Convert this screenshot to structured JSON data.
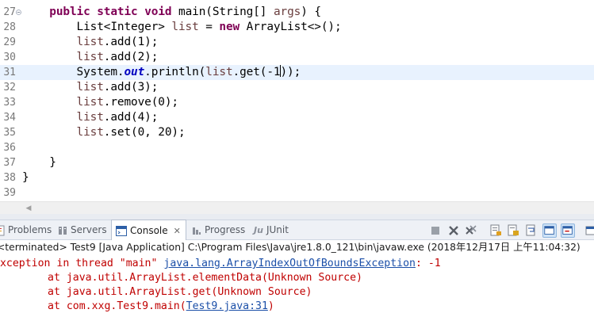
{
  "editor": {
    "lines": [
      {
        "no": "27",
        "fold": true,
        "tokens": [
          {
            "t": "    "
          },
          {
            "t": "public",
            "c": "kw"
          },
          {
            "t": " "
          },
          {
            "t": "static",
            "c": "kw"
          },
          {
            "t": " "
          },
          {
            "t": "void",
            "c": "kw"
          },
          {
            "t": " main(String[] "
          },
          {
            "t": "args",
            "c": "param"
          },
          {
            "t": ") {"
          }
        ]
      },
      {
        "no": "28",
        "tokens": [
          {
            "t": "        List<Integer> "
          },
          {
            "t": "list",
            "c": "var"
          },
          {
            "t": " = "
          },
          {
            "t": "new",
            "c": "kw"
          },
          {
            "t": " ArrayList<>();"
          }
        ]
      },
      {
        "no": "29",
        "tokens": [
          {
            "t": "        "
          },
          {
            "t": "list",
            "c": "var"
          },
          {
            "t": ".add(1);"
          }
        ]
      },
      {
        "no": "30",
        "tokens": [
          {
            "t": "        "
          },
          {
            "t": "list",
            "c": "var"
          },
          {
            "t": ".add(2);"
          }
        ]
      },
      {
        "no": "31",
        "current": true,
        "tokens": [
          {
            "t": "        System."
          },
          {
            "t": "out",
            "c": "static"
          },
          {
            "t": ".println("
          },
          {
            "t": "list",
            "c": "var"
          },
          {
            "t": ".get(-1"
          },
          {
            "caret": true
          },
          {
            "t": "));"
          }
        ]
      },
      {
        "no": "32",
        "tokens": [
          {
            "t": "        "
          },
          {
            "t": "list",
            "c": "var"
          },
          {
            "t": ".add(3);"
          }
        ]
      },
      {
        "no": "33",
        "tokens": [
          {
            "t": "        "
          },
          {
            "t": "list",
            "c": "var"
          },
          {
            "t": ".remove(0);"
          }
        ]
      },
      {
        "no": "34",
        "tokens": [
          {
            "t": "        "
          },
          {
            "t": "list",
            "c": "var"
          },
          {
            "t": ".add(4);"
          }
        ]
      },
      {
        "no": "35",
        "tokens": [
          {
            "t": "        "
          },
          {
            "t": "list",
            "c": "var"
          },
          {
            "t": ".set(0, 20);"
          }
        ]
      },
      {
        "no": "36",
        "tokens": []
      },
      {
        "no": "37",
        "tokens": [
          {
            "t": "    }"
          }
        ]
      },
      {
        "no": "38",
        "tokens": [
          {
            "t": "}"
          }
        ]
      },
      {
        "no": "39",
        "tokens": []
      }
    ]
  },
  "tabs": {
    "problems": "Problems",
    "servers": "Servers",
    "console": "Console",
    "console_close": "✕",
    "progress": "Progress",
    "junit": "JUnit"
  },
  "console": {
    "terminated_line": "<terminated> Test9 [Java Application] C:\\Program Files\\Java\\jre1.8.0_121\\bin\\javaw.exe (2018年12月17日 上午11:04:32)",
    "exception_prefix": "Exception in thread \"main\" ",
    "exception_class": "java.lang.ArrayIndexOutOfBoundsException",
    "exception_suffix": ": -1",
    "frames": [
      {
        "text": "at java.util.ArrayList.elementData(Unknown Source)"
      },
      {
        "text": "at java.util.ArrayList.get(Unknown Source)"
      },
      {
        "text": "at com.xxg.Test9.main(",
        "link": "Test9.java:31",
        "after": ")"
      }
    ]
  },
  "colors": {
    "keyword": "#7f0055",
    "variable": "#6a3e3e",
    "static_field": "#0000c0",
    "current_line": "#e8f2fe",
    "error_text": "#c00000",
    "link": "#1b4fa8"
  }
}
